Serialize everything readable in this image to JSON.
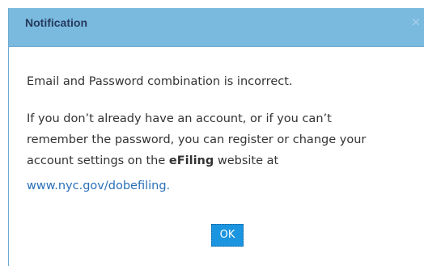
{
  "dialog": {
    "title": "Notification",
    "close_label": "×",
    "message_line1": "Email and Password combination is incorrect.",
    "message_line2": "If you don’t already have an account, or if you can’t",
    "message_line3": "remember the password, you can register or change your",
    "message_line4_before": "account settings on the ",
    "message_line4_bold": "eFiling",
    "message_line4_after": " website at",
    "link_text": "www.nyc.gov/dobefiling.",
    "ok_label": "OK"
  },
  "colors": {
    "header_bg": "#7bbadf",
    "title_text": "#253a5c",
    "body_text": "#333333",
    "link_text": "#2a6fb7",
    "ok_button_bg": "#1b95e0"
  }
}
